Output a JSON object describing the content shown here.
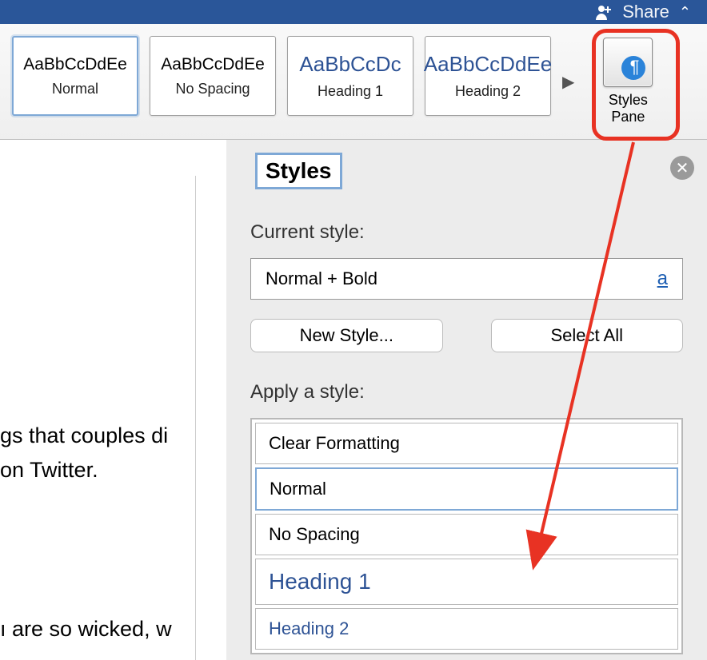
{
  "topbar": {
    "share_label": "Share"
  },
  "ribbon": {
    "styles": [
      {
        "sample": "AaBbCcDdEe",
        "name": "Normal",
        "sample_class": "normal",
        "selected": true
      },
      {
        "sample": "AaBbCcDdEe",
        "name": "No Spacing",
        "sample_class": "normal",
        "selected": false
      },
      {
        "sample": "AaBbCcDc",
        "name": "Heading 1",
        "sample_class": "heading",
        "selected": false
      },
      {
        "sample": "AaBbCcDdEe",
        "name": "Heading 2",
        "sample_class": "heading",
        "selected": false
      }
    ],
    "styles_pane_label_1": "Styles",
    "styles_pane_label_2": "Pane"
  },
  "document": {
    "line1": "gs that couples di",
    "line2": "on Twitter.",
    "line3": "ı are so wicked, w"
  },
  "panel": {
    "title": "Styles",
    "current_label": "Current style:",
    "current_value": "Normal + Bold",
    "dropdown_glyph": "a",
    "new_style_btn": "New Style...",
    "select_all_btn": "Select All",
    "apply_label": "Apply a style:",
    "list": [
      {
        "label": "Clear Formatting",
        "class": "",
        "active": false
      },
      {
        "label": "Normal",
        "class": "",
        "active": true
      },
      {
        "label": "No Spacing",
        "class": "",
        "active": false
      },
      {
        "label": "Heading 1",
        "class": "heading1",
        "active": false
      },
      {
        "label": "Heading 2",
        "class": "heading2",
        "active": false
      }
    ]
  }
}
